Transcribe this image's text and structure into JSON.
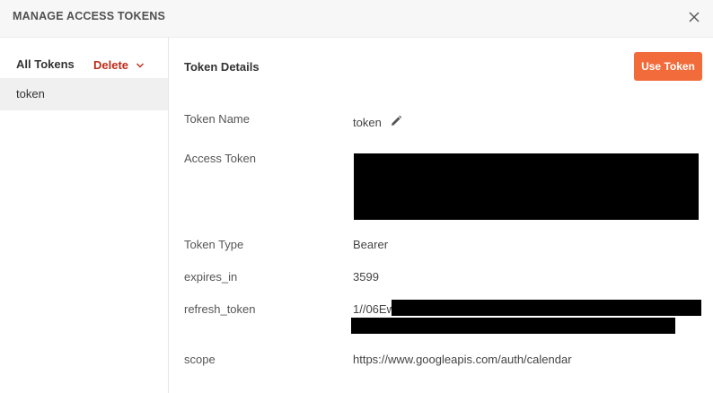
{
  "header": {
    "title": "MANAGE ACCESS TOKENS",
    "close_icon": "close-icon"
  },
  "sidebar": {
    "heading": "All Tokens",
    "delete_label": "Delete",
    "delete_color": "#c02a1a",
    "items": [
      {
        "label": "token"
      }
    ]
  },
  "details": {
    "title": "Token Details",
    "use_token_label": "Use Token",
    "accent_color": "#f26b3a",
    "fields": {
      "token_name": {
        "label": "Token Name",
        "value": "token"
      },
      "access_token": {
        "label": "Access Token"
      },
      "token_type": {
        "label": "Token Type",
        "value": "Bearer"
      },
      "expires_in": {
        "label": "expires_in",
        "value": "3599"
      },
      "refresh_token": {
        "label": "refresh_token",
        "value": "1//06Ew"
      },
      "scope": {
        "label": "scope",
        "value": "https://www.googleapis.com/auth/calendar"
      }
    }
  }
}
